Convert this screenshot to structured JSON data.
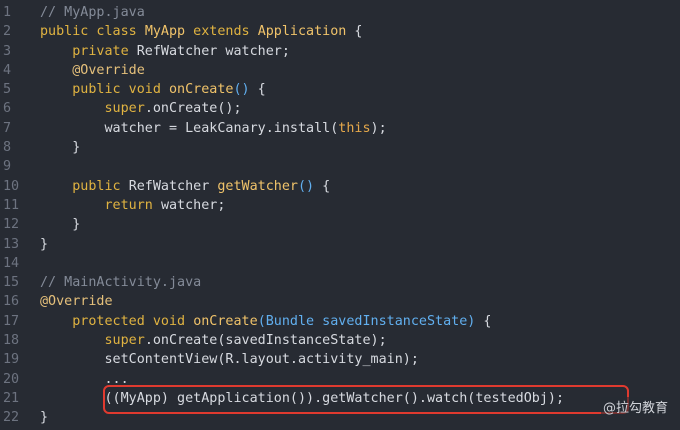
{
  "lines": [
    {
      "n": "1",
      "tokens": [
        {
          "c": "c",
          "t": "// MyApp.java"
        }
      ]
    },
    {
      "n": "2",
      "tokens": [
        {
          "c": "kw",
          "t": "public class "
        },
        {
          "c": "fn",
          "t": "MyApp"
        },
        {
          "c": "kw",
          "t": " extends "
        },
        {
          "c": "fn",
          "t": "Application"
        },
        {
          "c": "p",
          "t": " {"
        }
      ]
    },
    {
      "n": "3",
      "tokens": [
        {
          "c": "p",
          "t": "    "
        },
        {
          "c": "kw",
          "t": "private "
        },
        {
          "c": "p",
          "t": "RefWatcher watcher;"
        }
      ]
    },
    {
      "n": "4",
      "tokens": [
        {
          "c": "p",
          "t": "    "
        },
        {
          "c": "an",
          "t": "@Override"
        }
      ]
    },
    {
      "n": "5",
      "tokens": [
        {
          "c": "p",
          "t": "    "
        },
        {
          "c": "kw",
          "t": "public void "
        },
        {
          "c": "fn",
          "t": "onCreate"
        },
        {
          "c": "b",
          "t": "()"
        },
        {
          "c": "p",
          "t": " {"
        }
      ]
    },
    {
      "n": "6",
      "tokens": [
        {
          "c": "p",
          "t": "        "
        },
        {
          "c": "kw",
          "t": "super"
        },
        {
          "c": "p",
          "t": ".onCreate();"
        }
      ]
    },
    {
      "n": "7",
      "tokens": [
        {
          "c": "p",
          "t": "        watcher = LeakCanary.install("
        },
        {
          "c": "th",
          "t": "this"
        },
        {
          "c": "p",
          "t": ");"
        }
      ]
    },
    {
      "n": "8",
      "tokens": [
        {
          "c": "p",
          "t": "    }"
        }
      ]
    },
    {
      "n": "9",
      "tokens": []
    },
    {
      "n": "10",
      "tokens": [
        {
          "c": "p",
          "t": "    "
        },
        {
          "c": "kw",
          "t": "public "
        },
        {
          "c": "p",
          "t": "RefWatcher "
        },
        {
          "c": "fn",
          "t": "getWatcher"
        },
        {
          "c": "b",
          "t": "()"
        },
        {
          "c": "p",
          "t": " {"
        }
      ]
    },
    {
      "n": "11",
      "tokens": [
        {
          "c": "p",
          "t": "        "
        },
        {
          "c": "kw",
          "t": "return "
        },
        {
          "c": "p",
          "t": "watcher;"
        }
      ]
    },
    {
      "n": "12",
      "tokens": [
        {
          "c": "p",
          "t": "    }"
        }
      ]
    },
    {
      "n": "13",
      "tokens": [
        {
          "c": "p",
          "t": "}"
        }
      ]
    },
    {
      "n": "14",
      "tokens": []
    },
    {
      "n": "15",
      "tokens": [
        {
          "c": "c",
          "t": "// MainActivity.java"
        }
      ]
    },
    {
      "n": "16",
      "tokens": [
        {
          "c": "an",
          "t": "@Override"
        }
      ]
    },
    {
      "n": "17",
      "tokens": [
        {
          "c": "p",
          "t": "    "
        },
        {
          "c": "kw",
          "t": "protected void "
        },
        {
          "c": "fn",
          "t": "onCreate"
        },
        {
          "c": "b",
          "t": "(Bundle savedInstanceState)"
        },
        {
          "c": "p",
          "t": " {"
        }
      ]
    },
    {
      "n": "18",
      "tokens": [
        {
          "c": "p",
          "t": "        "
        },
        {
          "c": "kw",
          "t": "super"
        },
        {
          "c": "p",
          "t": ".onCreate(savedInstanceState);"
        }
      ]
    },
    {
      "n": "19",
      "tokens": [
        {
          "c": "p",
          "t": "        setContentView(R.layout.activity_main);"
        }
      ]
    },
    {
      "n": "20",
      "tokens": [
        {
          "c": "p",
          "t": "        ..."
        }
      ]
    },
    {
      "n": "21",
      "tokens": [
        {
          "c": "p",
          "t": "        ((MyApp) getApplication()).getWatcher().watch(testedObj);"
        }
      ]
    },
    {
      "n": "22",
      "tokens": [
        {
          "c": "p",
          "t": "}"
        }
      ]
    }
  ],
  "watermark": "@拉勾教育",
  "colors": {
    "background": "#272b33",
    "highlight_border": "#e03a2f",
    "keyword": "#e0b341",
    "comment": "#848b98",
    "line_number": "#6d7380"
  }
}
